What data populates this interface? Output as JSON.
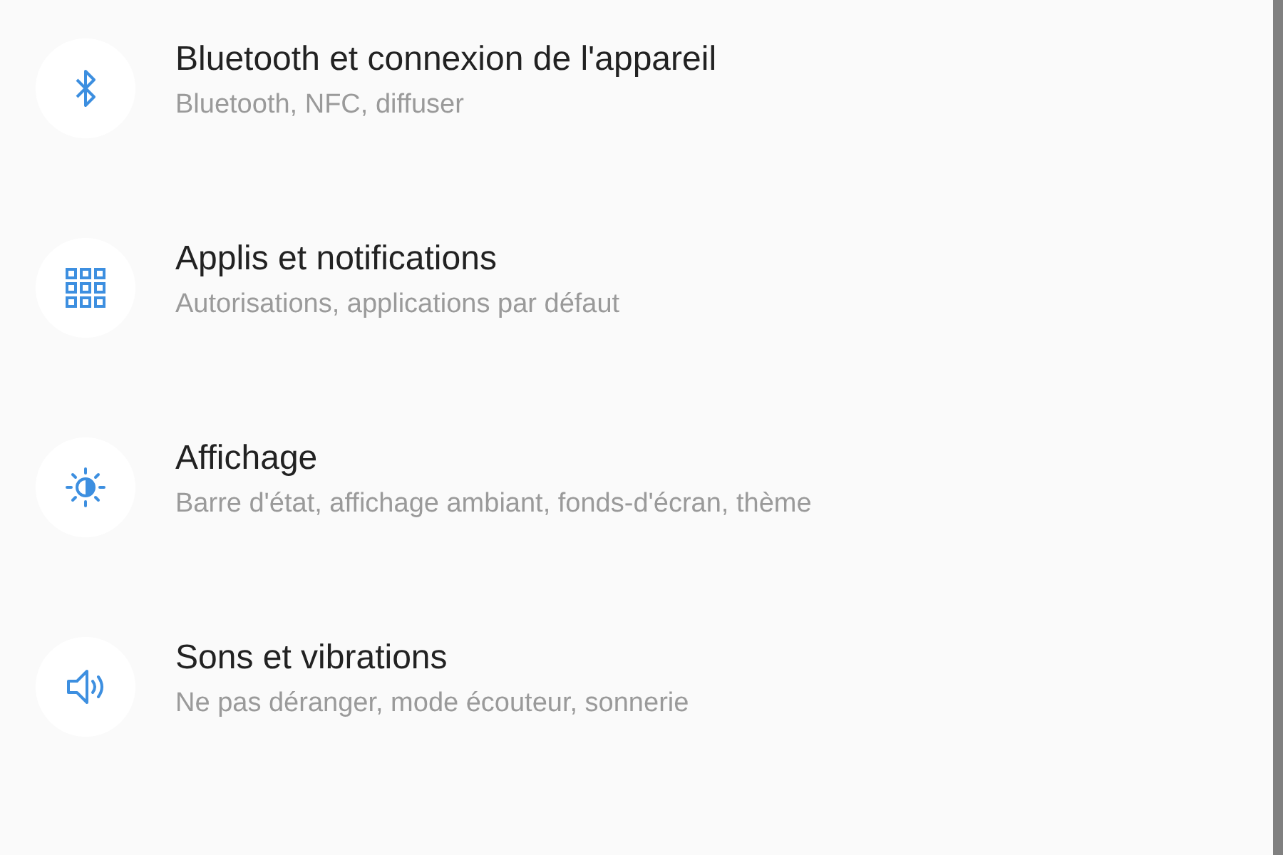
{
  "settings": [
    {
      "kind": "bluetooth",
      "title": "Bluetooth et connexion de l'appareil",
      "subtitle": "Bluetooth, NFC, diffuser"
    },
    {
      "kind": "apps",
      "title": "Applis et notifications",
      "subtitle": "Autorisations, applications par défaut"
    },
    {
      "kind": "display",
      "title": "Affichage",
      "subtitle": "Barre d'état, affichage ambiant, fonds-d'écran, thème"
    },
    {
      "kind": "sound",
      "title": "Sons et vibrations",
      "subtitle": "Ne pas déranger, mode écouteur, sonnerie"
    }
  ]
}
